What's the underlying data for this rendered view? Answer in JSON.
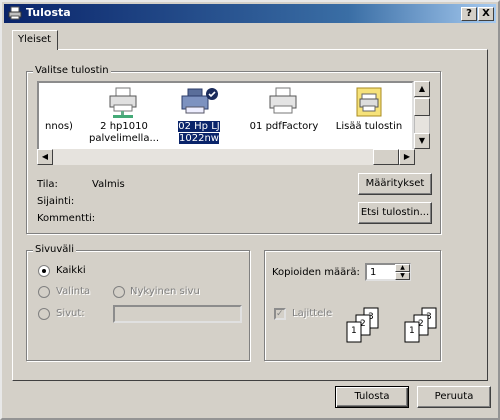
{
  "window": {
    "title": "Tulosta",
    "help_button": "?",
    "close_button": "X"
  },
  "tabs": [
    {
      "label": "Yleiset"
    }
  ],
  "printer_group": {
    "label": "Valitse tulostin",
    "printers": [
      {
        "label": "nnos)"
      },
      {
        "label": "2 hp1010 palvelimella..."
      },
      {
        "label": "02 Hp LJ 1022nw",
        "selected": true
      },
      {
        "label": "01 pdfFactory"
      },
      {
        "label": "Lisää tulostin"
      }
    ],
    "status_label": "Tila:",
    "status_value": "Valmis",
    "location_label": "Sijainti:",
    "location_value": "",
    "comment_label": "Kommentti:",
    "comment_value": "",
    "preferences_button": "Määritykset",
    "find_printer_button": "Etsi tulostin..."
  },
  "page_range": {
    "label": "Sivuväli",
    "all": "Kaikki",
    "selection": "Valinta",
    "current_page": "Nykyinen sivu",
    "pages": "Sivut:",
    "pages_value": "",
    "selected_option": "Kaikki"
  },
  "copies": {
    "label": "Kopioiden määrä:",
    "value": "1",
    "collate_label": "Lajittele",
    "collate_checked": true,
    "collate_icon_pages": [
      "1",
      "2",
      "3",
      "1",
      "2",
      "3"
    ]
  },
  "footer": {
    "print_button": "Tulosta",
    "cancel_button": "Peruuta"
  }
}
